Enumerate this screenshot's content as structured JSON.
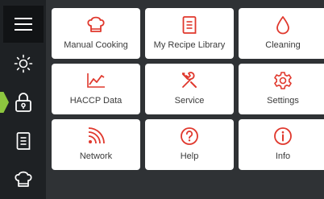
{
  "colors": {
    "accent": "#e0382d",
    "sidebar_bg": "#1e2124",
    "panel_bg": "#2f3235",
    "handle": "#8dc63f",
    "tile_bg": "#ffffff",
    "label": "#3a3a3a"
  },
  "sidebar": {
    "items": [
      {
        "icon": "menu-icon"
      },
      {
        "icon": "brightness-icon"
      },
      {
        "icon": "lock-icon"
      },
      {
        "icon": "recipe-book-icon"
      },
      {
        "icon": "chef-hat-icon"
      }
    ]
  },
  "tiles": [
    {
      "label": "Manual Cooking",
      "icon": "chef-hat-icon"
    },
    {
      "label": "My Recipe Library",
      "icon": "recipe-book-icon"
    },
    {
      "label": "Cleaning",
      "icon": "water-drop-icon"
    },
    {
      "label": "HACCP Data",
      "icon": "line-chart-icon"
    },
    {
      "label": "Service",
      "icon": "tools-icon"
    },
    {
      "label": "Settings",
      "icon": "gear-icon"
    },
    {
      "label": "Network",
      "icon": "wifi-signal-icon"
    },
    {
      "label": "Help",
      "icon": "help-icon"
    },
    {
      "label": "Info",
      "icon": "info-icon"
    }
  ]
}
